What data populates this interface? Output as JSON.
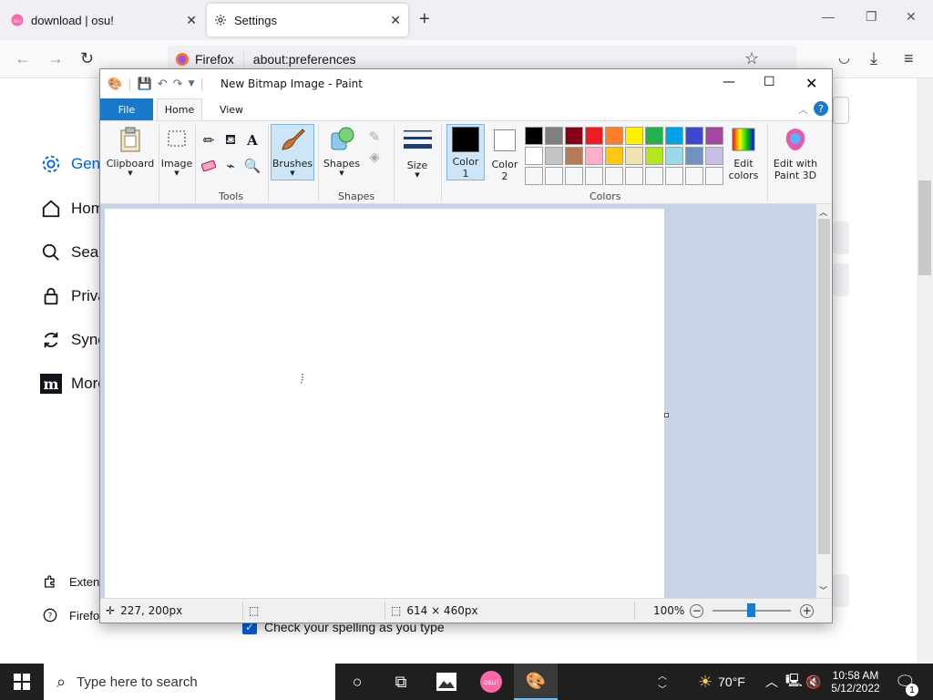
{
  "firefox": {
    "tabs": [
      {
        "title": "download | osu!",
        "icon": "osu-icon"
      },
      {
        "title": "Settings",
        "icon": "gear-icon"
      }
    ],
    "url_brand": "Firefox",
    "url": "about:preferences",
    "sidebar": [
      {
        "label": "Gene",
        "icon": "gear-icon"
      },
      {
        "label": "Hom",
        "icon": "home-icon"
      },
      {
        "label": "Sear",
        "icon": "search-icon"
      },
      {
        "label": "Priva",
        "icon": "lock-icon"
      },
      {
        "label": "Sync",
        "icon": "sync-icon"
      },
      {
        "label": "More",
        "icon": "mozilla-icon"
      }
    ],
    "sidebar_bottom": [
      {
        "label": "Exten",
        "icon": "puzzle-icon"
      },
      {
        "label": "Firefo",
        "icon": "help-icon"
      }
    ],
    "spellcheck_label": "Check your spelling as you type",
    "spellcheck_checked": true
  },
  "paint": {
    "title": "New Bitmap Image - Paint",
    "tabs": {
      "file": "File",
      "home": "Home",
      "view": "View"
    },
    "ribbon": {
      "clipboard": "Clipboard",
      "image": "Image",
      "tools_label": "Tools",
      "brushes": "Brushes",
      "shapes": "Shapes",
      "shapes_label": "Shapes",
      "size": "Size",
      "color1": "Color\n1",
      "color1_a": "Color",
      "color1_b": "1",
      "color2_a": "Color",
      "color2_b": "2",
      "colors_label": "Colors",
      "edit_colors_a": "Edit",
      "edit_colors_b": "colors",
      "paint3d_a": "Edit with",
      "paint3d_b": "Paint 3D"
    },
    "palette_row1": [
      "#000000",
      "#7f7f7f",
      "#880015",
      "#ed1c24",
      "#ff7f27",
      "#fff200",
      "#22b14c",
      "#00a2e8",
      "#3f48cc",
      "#a349a4"
    ],
    "palette_row2": [
      "#ffffff",
      "#c3c3c3",
      "#b97a57",
      "#ffaec9",
      "#ffc90e",
      "#efe4b0",
      "#b5e61d",
      "#99d9ea",
      "#7092be",
      "#c8bfe7"
    ],
    "status": {
      "cursor_pos": "227, 200px",
      "canvas_size": "614 × 460px",
      "zoom": "100%"
    }
  },
  "taskbar": {
    "search_placeholder": "Type here to search",
    "weather": "70°F",
    "time": "10:58 AM",
    "date": "5/12/2022",
    "notifications": "1",
    "osu_label": "osu!"
  }
}
